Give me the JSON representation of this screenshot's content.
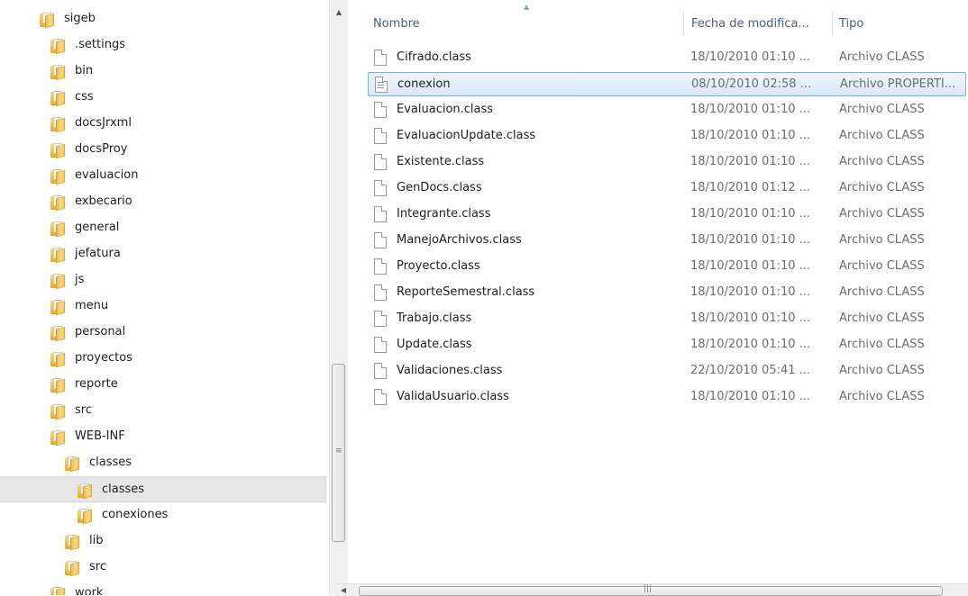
{
  "tree": {
    "items": [
      {
        "label": "sigeb",
        "indent": 0
      },
      {
        "label": ".settings",
        "indent": 1
      },
      {
        "label": "bin",
        "indent": 1
      },
      {
        "label": "css",
        "indent": 1
      },
      {
        "label": "docsJrxml",
        "indent": 1
      },
      {
        "label": "docsProy",
        "indent": 1
      },
      {
        "label": "evaluacion",
        "indent": 1
      },
      {
        "label": "exbecario",
        "indent": 1
      },
      {
        "label": "general",
        "indent": 1
      },
      {
        "label": "jefatura",
        "indent": 1
      },
      {
        "label": "js",
        "indent": 1
      },
      {
        "label": "menu",
        "indent": 1
      },
      {
        "label": "personal",
        "indent": 1
      },
      {
        "label": "proyectos",
        "indent": 1
      },
      {
        "label": "reporte",
        "indent": 1
      },
      {
        "label": "src",
        "indent": 1
      },
      {
        "label": "WEB-INF",
        "indent": 1
      },
      {
        "label": "classes",
        "indent": 2
      },
      {
        "label": "classes",
        "indent": 3,
        "selected": true
      },
      {
        "label": "conexiones",
        "indent": 3
      },
      {
        "label": "lib",
        "indent": 2
      },
      {
        "label": "src",
        "indent": 2
      },
      {
        "label": "work",
        "indent": 1
      }
    ]
  },
  "list": {
    "columns": {
      "name": "Nombre",
      "date": "Fecha de modifica...",
      "type": "Tipo"
    },
    "files": [
      {
        "name": "Cifrado.class",
        "date": "18/10/2010 01:10 ...",
        "type": "Archivo CLASS",
        "icon": "class-file-icon"
      },
      {
        "name": "conexion",
        "date": "08/10/2010 02:58 ...",
        "type": "Archivo PROPERTI...",
        "icon": "properties-file-icon",
        "selected": true
      },
      {
        "name": "Evaluacion.class",
        "date": "18/10/2010 01:10 ...",
        "type": "Archivo CLASS",
        "icon": "class-file-icon"
      },
      {
        "name": "EvaluacionUpdate.class",
        "date": "18/10/2010 01:10 ...",
        "type": "Archivo CLASS",
        "icon": "class-file-icon"
      },
      {
        "name": "Existente.class",
        "date": "18/10/2010 01:10 ...",
        "type": "Archivo CLASS",
        "icon": "class-file-icon"
      },
      {
        "name": "GenDocs.class",
        "date": "18/10/2010 01:12 ...",
        "type": "Archivo CLASS",
        "icon": "class-file-icon"
      },
      {
        "name": "Integrante.class",
        "date": "18/10/2010 01:10 ...",
        "type": "Archivo CLASS",
        "icon": "class-file-icon"
      },
      {
        "name": "ManejoArchivos.class",
        "date": "18/10/2010 01:10 ...",
        "type": "Archivo CLASS",
        "icon": "class-file-icon"
      },
      {
        "name": "Proyecto.class",
        "date": "18/10/2010 01:10 ...",
        "type": "Archivo CLASS",
        "icon": "class-file-icon"
      },
      {
        "name": "ReporteSemestral.class",
        "date": "18/10/2010 01:10 ...",
        "type": "Archivo CLASS",
        "icon": "class-file-icon"
      },
      {
        "name": "Trabajo.class",
        "date": "18/10/2010 01:10 ...",
        "type": "Archivo CLASS",
        "icon": "class-file-icon"
      },
      {
        "name": "Update.class",
        "date": "18/10/2010 01:10 ...",
        "type": "Archivo CLASS",
        "icon": "class-file-icon"
      },
      {
        "name": "Validaciones.class",
        "date": "22/10/2010 05:41 ...",
        "type": "Archivo CLASS",
        "icon": "class-file-icon"
      },
      {
        "name": "ValidaUsuario.class",
        "date": "18/10/2010 01:10 ...",
        "type": "Archivo CLASS",
        "icon": "class-file-icon"
      }
    ]
  },
  "colors": {
    "selection_border": "#84acdd",
    "header_text": "#4c607a",
    "folder_yellow": "#f2c55c"
  }
}
